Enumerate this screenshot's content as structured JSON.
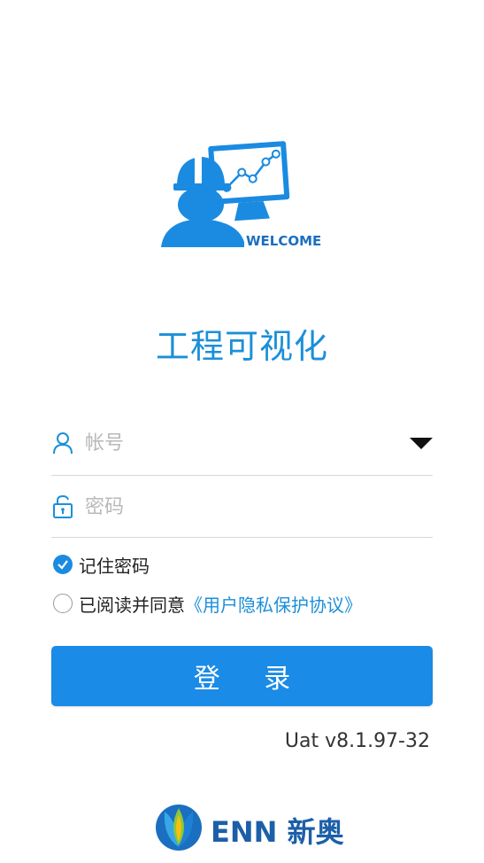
{
  "hero": {
    "badge_text": "WELCOME",
    "icon": "engineer-monitor-illustration"
  },
  "app": {
    "title": "工程可视化"
  },
  "login_form": {
    "account": {
      "placeholder": "帐号",
      "value": "",
      "icon": "user-icon",
      "dropdown_icon": "triangle-down-icon"
    },
    "password": {
      "placeholder": "密码",
      "value": "",
      "icon": "lock-icon"
    },
    "remember_password": {
      "label": "记住密码",
      "checked": true
    },
    "agreement": {
      "prefix": "已阅读并同意",
      "link_text": "《用户隐私保护协议》",
      "checked": false
    },
    "submit_label": "登 录"
  },
  "version": "Uat v8.1.97-32",
  "brand": {
    "name": "ENN 新奥",
    "logo_icon": "enn-petal-logo-icon"
  },
  "colors": {
    "primary": "#1a8be6",
    "title": "#1b8fd9",
    "brand_text": "#1c5fa8"
  }
}
